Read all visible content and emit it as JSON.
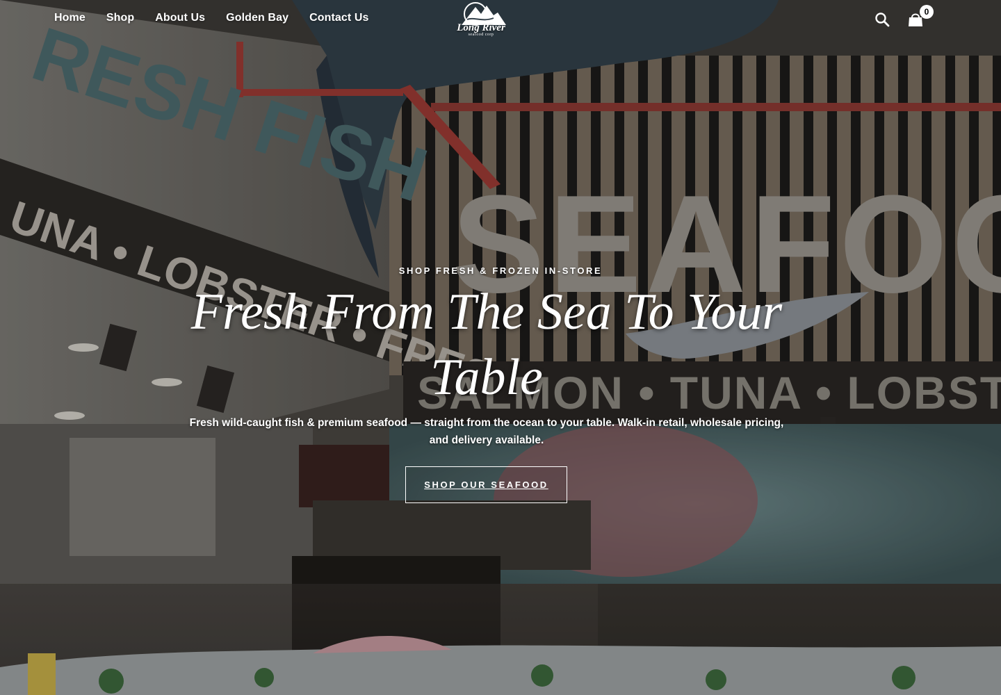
{
  "header": {
    "nav": [
      {
        "label": "Home"
      },
      {
        "label": "Shop"
      },
      {
        "label": "About Us"
      },
      {
        "label": "Golden Bay"
      },
      {
        "label": "Contact Us"
      }
    ],
    "logo": {
      "name": "Long River",
      "tagline": "seafood corp"
    },
    "search_icon": "search-icon",
    "cart_icon": "shopping-bag-icon",
    "cart_count": "0"
  },
  "hero": {
    "eyebrow": "SHOP FRESH & FROZEN IN-STORE",
    "headline": "Fresh From The Sea To Your Table",
    "subtext": "Fresh wild-caught fish & premium seafood — straight from the ocean to your table. Walk-in retail, wholesale pricing, and delivery available.",
    "cta_label": "SHOP OUR SEAFOOD"
  },
  "background": {
    "signage": [
      "FRESH FISH",
      "TUNA • LOBSTER • FRESH FISH",
      "SEAFOOD",
      "SALMON • TUNA • LOBSTER"
    ]
  },
  "colors": {
    "accent": "#ffffff",
    "overlay": "#000000"
  }
}
